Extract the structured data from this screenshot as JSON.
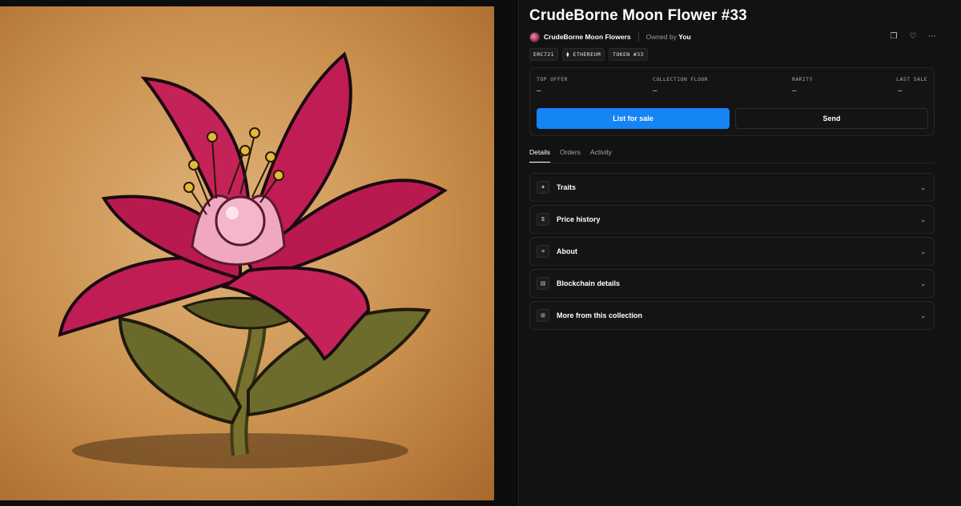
{
  "nft": {
    "title": "CrudeBorne Moon Flower #33",
    "collection_name": "CrudeBorne Moon Flowers",
    "owned_by_prefix": "Owned by",
    "owner": "You"
  },
  "chips": [
    "ERC721",
    "⧫ ETHEREUM",
    "TOKEN #33"
  ],
  "stats": {
    "top_offer": {
      "label": "TOP OFFER",
      "value": "–"
    },
    "collection_floor": {
      "label": "COLLECTION FLOOR",
      "value": "–"
    },
    "rarity": {
      "label": "RARITY",
      "value": "–"
    },
    "last_sale": {
      "label": "LAST SALE",
      "value": "–"
    }
  },
  "buttons": {
    "list_for_sale": "List for sale",
    "send": "Send"
  },
  "tabs": [
    {
      "label": "Details",
      "active": true
    },
    {
      "label": "Orders",
      "active": false
    },
    {
      "label": "Activity",
      "active": false
    }
  ],
  "sections": [
    {
      "label": "Traits",
      "icon": "sparkle-icon",
      "glyph": "✦"
    },
    {
      "label": "Price history",
      "icon": "dollar-icon",
      "glyph": "$"
    },
    {
      "label": "About",
      "icon": "text-edit-icon",
      "glyph": "≡"
    },
    {
      "label": "Blockchain details",
      "icon": "table-icon",
      "glyph": "▤"
    },
    {
      "label": "More from this collection",
      "icon": "grid-icon",
      "glyph": "⊞"
    }
  ],
  "icons": {
    "copy": "❐",
    "heart": "♡",
    "more": "⋯",
    "chevron": "⌄"
  },
  "colors": {
    "accent": "#1584f4",
    "background": "#121212"
  }
}
